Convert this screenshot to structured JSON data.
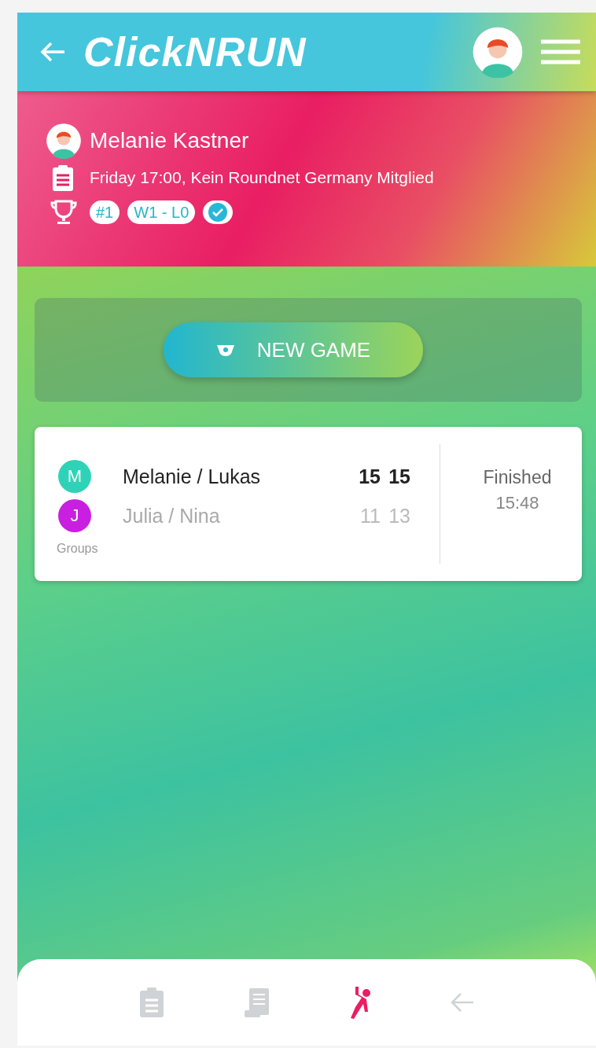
{
  "header": {
    "logo": "ClickNRUN"
  },
  "profile": {
    "name": "Melanie Kastner",
    "details": "Friday 17:00, Kein Roundnet Germany Mitglied",
    "badges": [
      {
        "kind": "text",
        "label": "#1"
      },
      {
        "kind": "text",
        "label": "W1 - L0"
      },
      {
        "kind": "check"
      }
    ]
  },
  "new_game_button": {
    "label": "NEW GAME"
  },
  "match": {
    "teams": [
      {
        "initial": "M",
        "color": "#2ed3b7",
        "name": "Melanie / Lukas",
        "scores": [
          "15",
          "15"
        ],
        "winner": true
      },
      {
        "initial": "J",
        "color": "#c81fe0",
        "name": "Julia / Nina",
        "scores": [
          "11",
          "13"
        ],
        "winner": false
      }
    ],
    "group": "Groups",
    "status": "Finished",
    "time": "15:48"
  },
  "bottom_nav": [
    {
      "kind": "clipboard",
      "selected": false
    },
    {
      "kind": "scroll",
      "selected": false
    },
    {
      "kind": "player",
      "selected": true
    },
    {
      "kind": "back",
      "selected": false
    }
  ]
}
